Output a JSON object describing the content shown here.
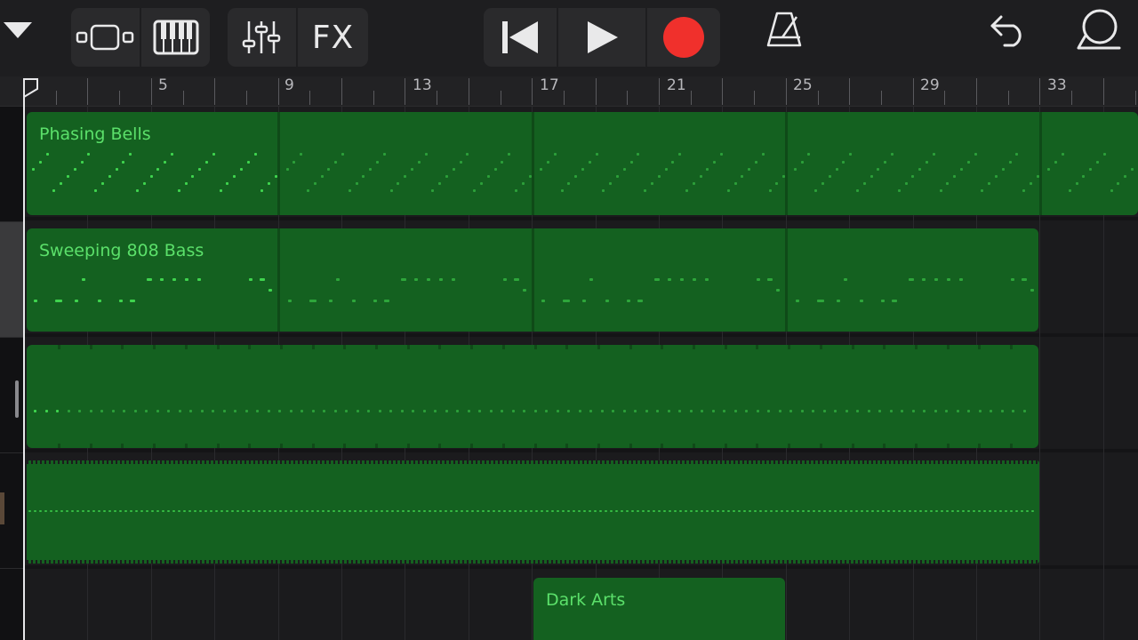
{
  "toolbar": {
    "tracks_dropdown_icon": "triangle-down-icon",
    "tracks_view_icon": "tracks-view-icon",
    "keyboard_icon": "piano-keyboard-icon",
    "mixer_icon": "mixer-sliders-icon",
    "fx_label": "FX",
    "go_to_start_icon": "skip-back-icon",
    "play_icon": "play-icon",
    "record_icon": "record-icon",
    "metronome_icon": "metronome-icon",
    "undo_icon": "undo-icon",
    "loop_icon": "loop-browser-icon"
  },
  "ruler": {
    "bar_numbers": [
      "5",
      "9",
      "13",
      "17",
      "21",
      "25",
      "29",
      "33"
    ]
  },
  "regions": {
    "phasing_bells": "Phasing Bells",
    "sweeping_808_bass": "Sweeping 808 Bass",
    "dark_arts": "Dark Arts"
  },
  "colors": {
    "region_fill": "#146120",
    "region_label": "#5be06a",
    "record_red": "#f0302c"
  }
}
